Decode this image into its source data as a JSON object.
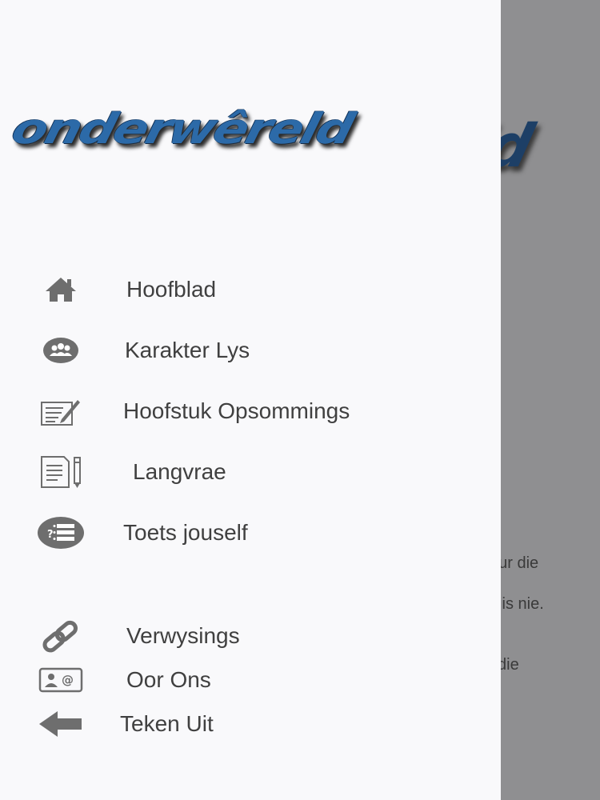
{
  "app": {
    "logo_text": "onderwêreld"
  },
  "background": {
    "logo_fragment": "ld",
    "text_fragments": [
      "eur die",
      "s is nie.",
      "l die"
    ]
  },
  "menu": {
    "items": [
      {
        "label": "Hoofblad",
        "icon": "home-icon"
      },
      {
        "label": "Karakter Lys",
        "icon": "group-icon"
      },
      {
        "label": "Hoofstuk Opsommings",
        "icon": "edit-note-icon"
      },
      {
        "label": "Langvrae",
        "icon": "document-pen-icon"
      },
      {
        "label": "Toets jouself",
        "icon": "quiz-list-icon"
      },
      {
        "label": "Verwysings",
        "icon": "link-icon"
      },
      {
        "label": "Oor Ons",
        "icon": "contact-card-icon"
      },
      {
        "label": "Teken Uit",
        "icon": "arrow-left-icon"
      }
    ]
  },
  "colors": {
    "logo_blue": "#2c6aa8",
    "icon_gray": "#707070",
    "drawer_bg": "#f9f9fb",
    "scrim_gray": "#8f8f91"
  }
}
